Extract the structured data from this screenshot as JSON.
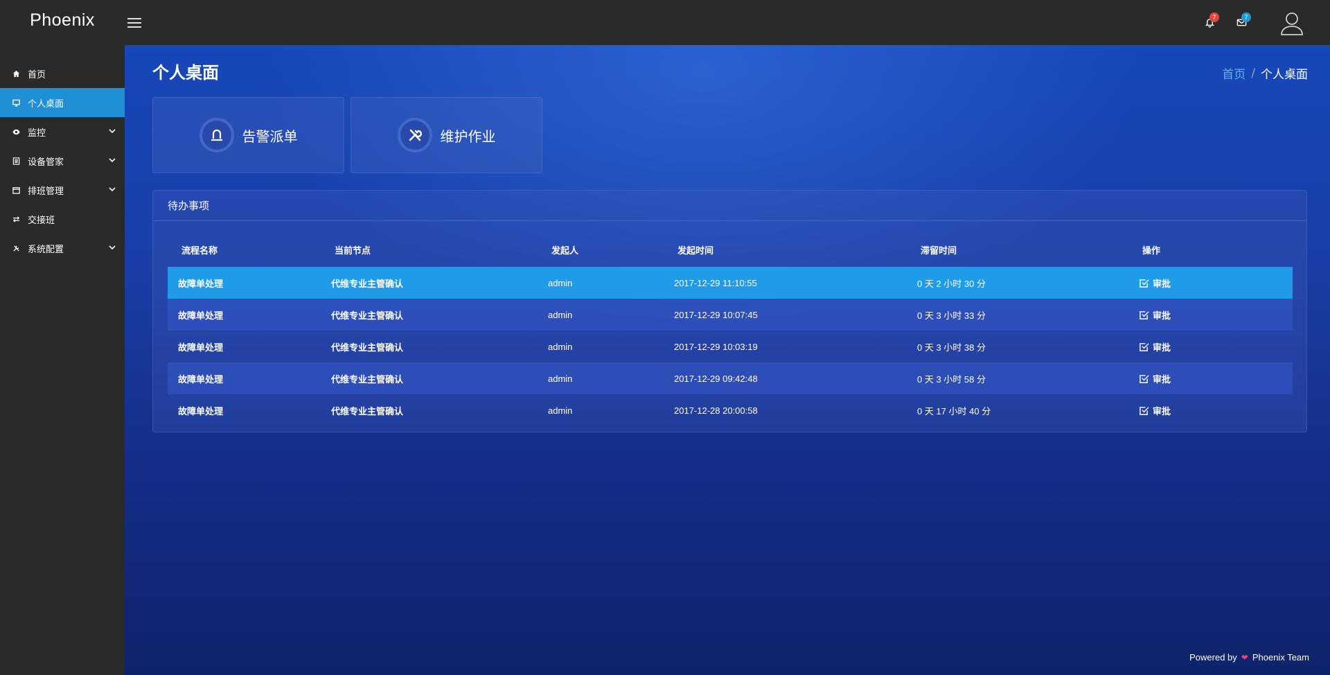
{
  "app": {
    "brand": "Phoenix"
  },
  "topbar": {
    "notifications": {
      "icon": "bell-icon",
      "count": "7",
      "color": "#e8453c"
    },
    "messages": {
      "icon": "envelope-icon",
      "count": "7",
      "color": "#1f9ad6"
    },
    "avatar_icon": "user-avatar-icon"
  },
  "sidebar": {
    "items": [
      {
        "label": "首页",
        "icon": "home-icon",
        "active": false,
        "expandable": false
      },
      {
        "label": "个人桌面",
        "icon": "monitor-icon",
        "active": true,
        "expandable": false
      },
      {
        "label": "监控",
        "icon": "eye-icon",
        "active": false,
        "expandable": true
      },
      {
        "label": "设备管家",
        "icon": "list-icon",
        "active": false,
        "expandable": true
      },
      {
        "label": "排班管理",
        "icon": "calendar-icon",
        "active": false,
        "expandable": true
      },
      {
        "label": "交接班",
        "icon": "exchange-icon",
        "active": false,
        "expandable": false
      },
      {
        "label": "系统配置",
        "icon": "tools-icon",
        "active": false,
        "expandable": true
      }
    ]
  },
  "main": {
    "title": "个人桌面",
    "breadcrumb": {
      "home": "首页",
      "separator": "/",
      "current": "个人桌面"
    },
    "quick_actions": [
      {
        "label": "告警派单",
        "icon": "alarm-light-icon"
      },
      {
        "label": "维护作业",
        "icon": "wrench-screwdriver-icon"
      }
    ]
  },
  "todo": {
    "title": "待办事项",
    "columns": [
      "流程名称",
      "当前节点",
      "发起人",
      "发起时间",
      "滞留时间",
      "操作"
    ],
    "rows": [
      {
        "process": "故障单处理",
        "node": "代维专业主管确认",
        "initiator": "admin",
        "start_time": "2017-12-29 11:10:55",
        "stay": "0 天 2 小时 30 分",
        "action": "审批"
      },
      {
        "process": "故障单处理",
        "node": "代维专业主管确认",
        "initiator": "admin",
        "start_time": "2017-12-29 10:07:45",
        "stay": "0 天 3 小时 33 分",
        "action": "审批"
      },
      {
        "process": "故障单处理",
        "node": "代维专业主管确认",
        "initiator": "admin",
        "start_time": "2017-12-29 10:03:19",
        "stay": "0 天 3 小时 38 分",
        "action": "审批"
      },
      {
        "process": "故障单处理",
        "node": "代维专业主管确认",
        "initiator": "admin",
        "start_time": "2017-12-29 09:42:48",
        "stay": "0 天 3 小时 58 分",
        "action": "审批"
      },
      {
        "process": "故障单处理",
        "node": "代维专业主管确认",
        "initiator": "admin",
        "start_time": "2017-12-28 20:00:58",
        "stay": "0 天 17 小时 40 分",
        "action": "审批"
      }
    ]
  },
  "footer": {
    "prefix": "Powered by",
    "suffix": "Phoenix Team"
  },
  "colors": {
    "sidebar_active": "#1f8fd6",
    "row_highlight": "#1f9be8",
    "link": "#5cb8f0"
  }
}
